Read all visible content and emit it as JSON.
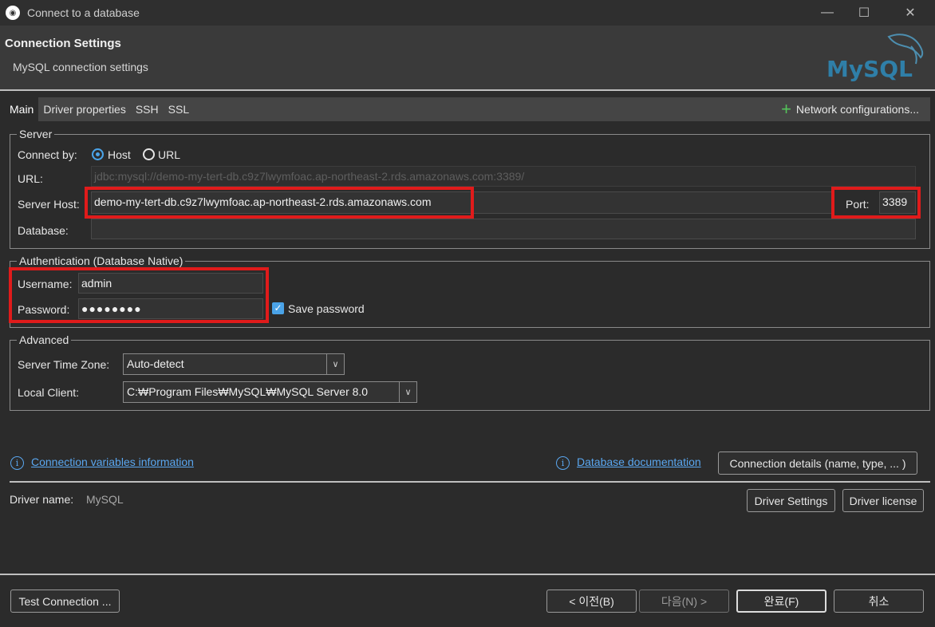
{
  "window": {
    "title": "Connect to a database"
  },
  "header": {
    "title": "Connection Settings",
    "subtitle": "MySQL connection settings",
    "logo_text": "MySQL"
  },
  "tabs": [
    {
      "label": "Main",
      "active": true
    },
    {
      "label": "Driver properties"
    },
    {
      "label": "SSH"
    },
    {
      "label": "SSL"
    }
  ],
  "network_config": {
    "label": "Network configurations...",
    "icon": "plus-icon"
  },
  "server": {
    "legend": "Server",
    "connect_by_label": "Connect by:",
    "host_option": "Host",
    "url_option": "URL",
    "url_label": "URL:",
    "url_value": "jdbc:mysql://demo-my-tert-db.c9z7lwymfoac.ap-northeast-2.rds.amazonaws.com:3389/",
    "host_label": "Server Host:",
    "host_value": "demo-my-tert-db.c9z7lwymfoac.ap-northeast-2.rds.amazonaws.com",
    "port_label": "Port:",
    "port_value": "3389",
    "database_label": "Database:",
    "database_value": ""
  },
  "auth": {
    "legend": "Authentication (Database Native)",
    "username_label": "Username:",
    "username_value": "admin",
    "password_label": "Password:",
    "password_value": "●●●●●●●●",
    "save_password_label": "Save password",
    "save_password_checked": true
  },
  "advanced": {
    "legend": "Advanced",
    "timezone_label": "Server Time Zone:",
    "timezone_value": "Auto-detect",
    "client_label": "Local Client:",
    "client_value": "C:₩Program Files₩MySQL₩MySQL Server 8.0"
  },
  "links": {
    "conn_vars": "Connection variables information",
    "db_docs": "Database documentation"
  },
  "buttons": {
    "conn_details": "Connection details (name, type, ... )",
    "driver_settings": "Driver Settings",
    "driver_license": "Driver license",
    "test_connection": "Test Connection ...",
    "back": "< 이전(B)",
    "next": "다음(N) >",
    "finish": "완료(F)",
    "cancel": "취소"
  },
  "driver": {
    "label": "Driver name:",
    "value": "MySQL"
  },
  "colors": {
    "accent": "#4aa3e8",
    "highlight": "#e01b1b",
    "link": "#5aa7f0",
    "plus": "#54c45a"
  }
}
